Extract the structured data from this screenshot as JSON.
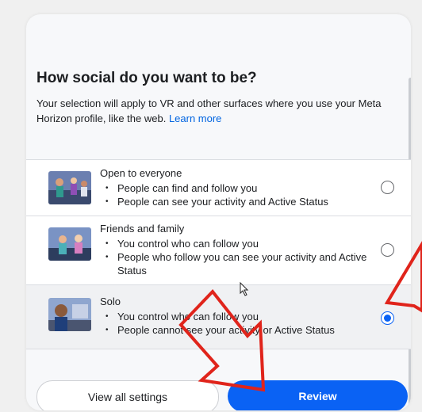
{
  "header": {
    "title": "How social do you want to be?",
    "subtitle": "Your selection will apply to VR and other surfaces where you use your Meta Horizon profile, like the web.",
    "learn_more": "Learn more"
  },
  "options": [
    {
      "title": "Open to everyone",
      "bullets": [
        "People can find and follow you",
        "People can see your activity and Active Status"
      ],
      "selected": false
    },
    {
      "title": "Friends and family",
      "bullets": [
        "You control who can follow you",
        "People who follow you can see your activity and Active Status"
      ],
      "selected": false
    },
    {
      "title": "Solo",
      "bullets": [
        "You control who can follow you",
        "People cannot see your activity or Active Status"
      ],
      "selected": true
    }
  ],
  "footer": {
    "secondary_label": "View all settings",
    "primary_label": "Review"
  },
  "colors": {
    "primary": "#0a62f4",
    "link": "#0064e0",
    "annotation_red": "#e0241b"
  }
}
